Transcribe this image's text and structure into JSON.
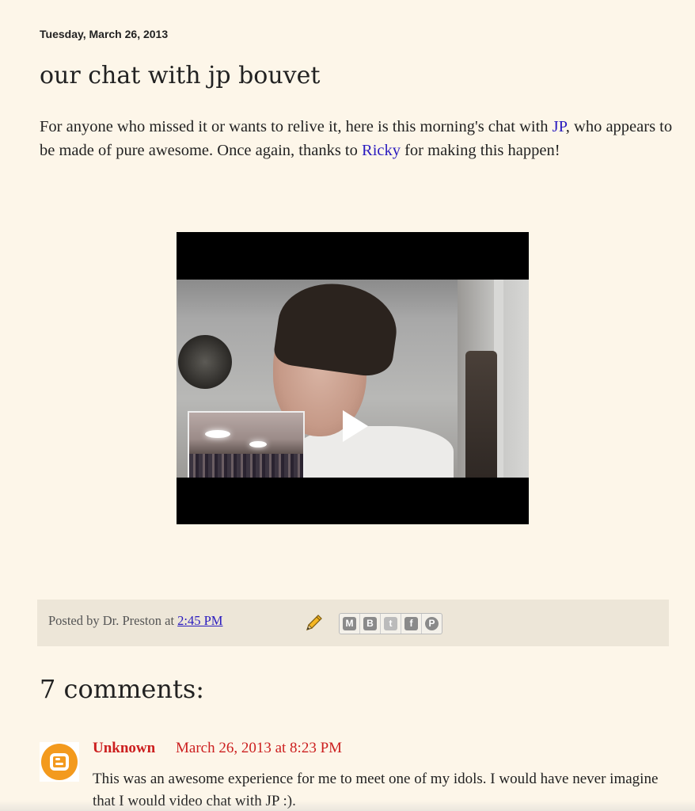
{
  "post": {
    "date": "Tuesday, March 26, 2013",
    "title": "our chat with jp bouvet",
    "body": {
      "part1": "For anyone who missed it or wants to relive it, here is this morning's chat with ",
      "link_jp": "JP",
      "part2": ", who appears to be made of pure awesome.  Once again, thanks to ",
      "link_ricky": "Ricky",
      "part3": " for making this happen!"
    },
    "video": {
      "play_icon": "play-icon"
    }
  },
  "footer": {
    "posted_by_prefix": "Posted by Dr. Preston at ",
    "time_link": "2:45 PM",
    "edit_icon": "pencil-icon",
    "share_buttons": [
      {
        "name": "email-icon",
        "glyph": "M"
      },
      {
        "name": "blogger-icon",
        "glyph": "B"
      },
      {
        "name": "twitter-icon",
        "glyph": "t"
      },
      {
        "name": "facebook-icon",
        "glyph": "f"
      },
      {
        "name": "pinterest-icon",
        "glyph": "P"
      }
    ]
  },
  "comments": {
    "heading": "7 comments:",
    "items": [
      {
        "author": "Unknown",
        "timestamp": "March 26, 2013 at 8:23 PM",
        "text": "This was an awesome experience for me to meet one of my idols. I would have never imagine that I would video chat with JP :).",
        "avatar_icon": "blogger-avatar-icon"
      }
    ]
  },
  "colors": {
    "background": "#fdf6e9",
    "link": "#2a1bbf",
    "comment_author": "#cc1f1f",
    "footer_bg": "#ede6d8"
  }
}
